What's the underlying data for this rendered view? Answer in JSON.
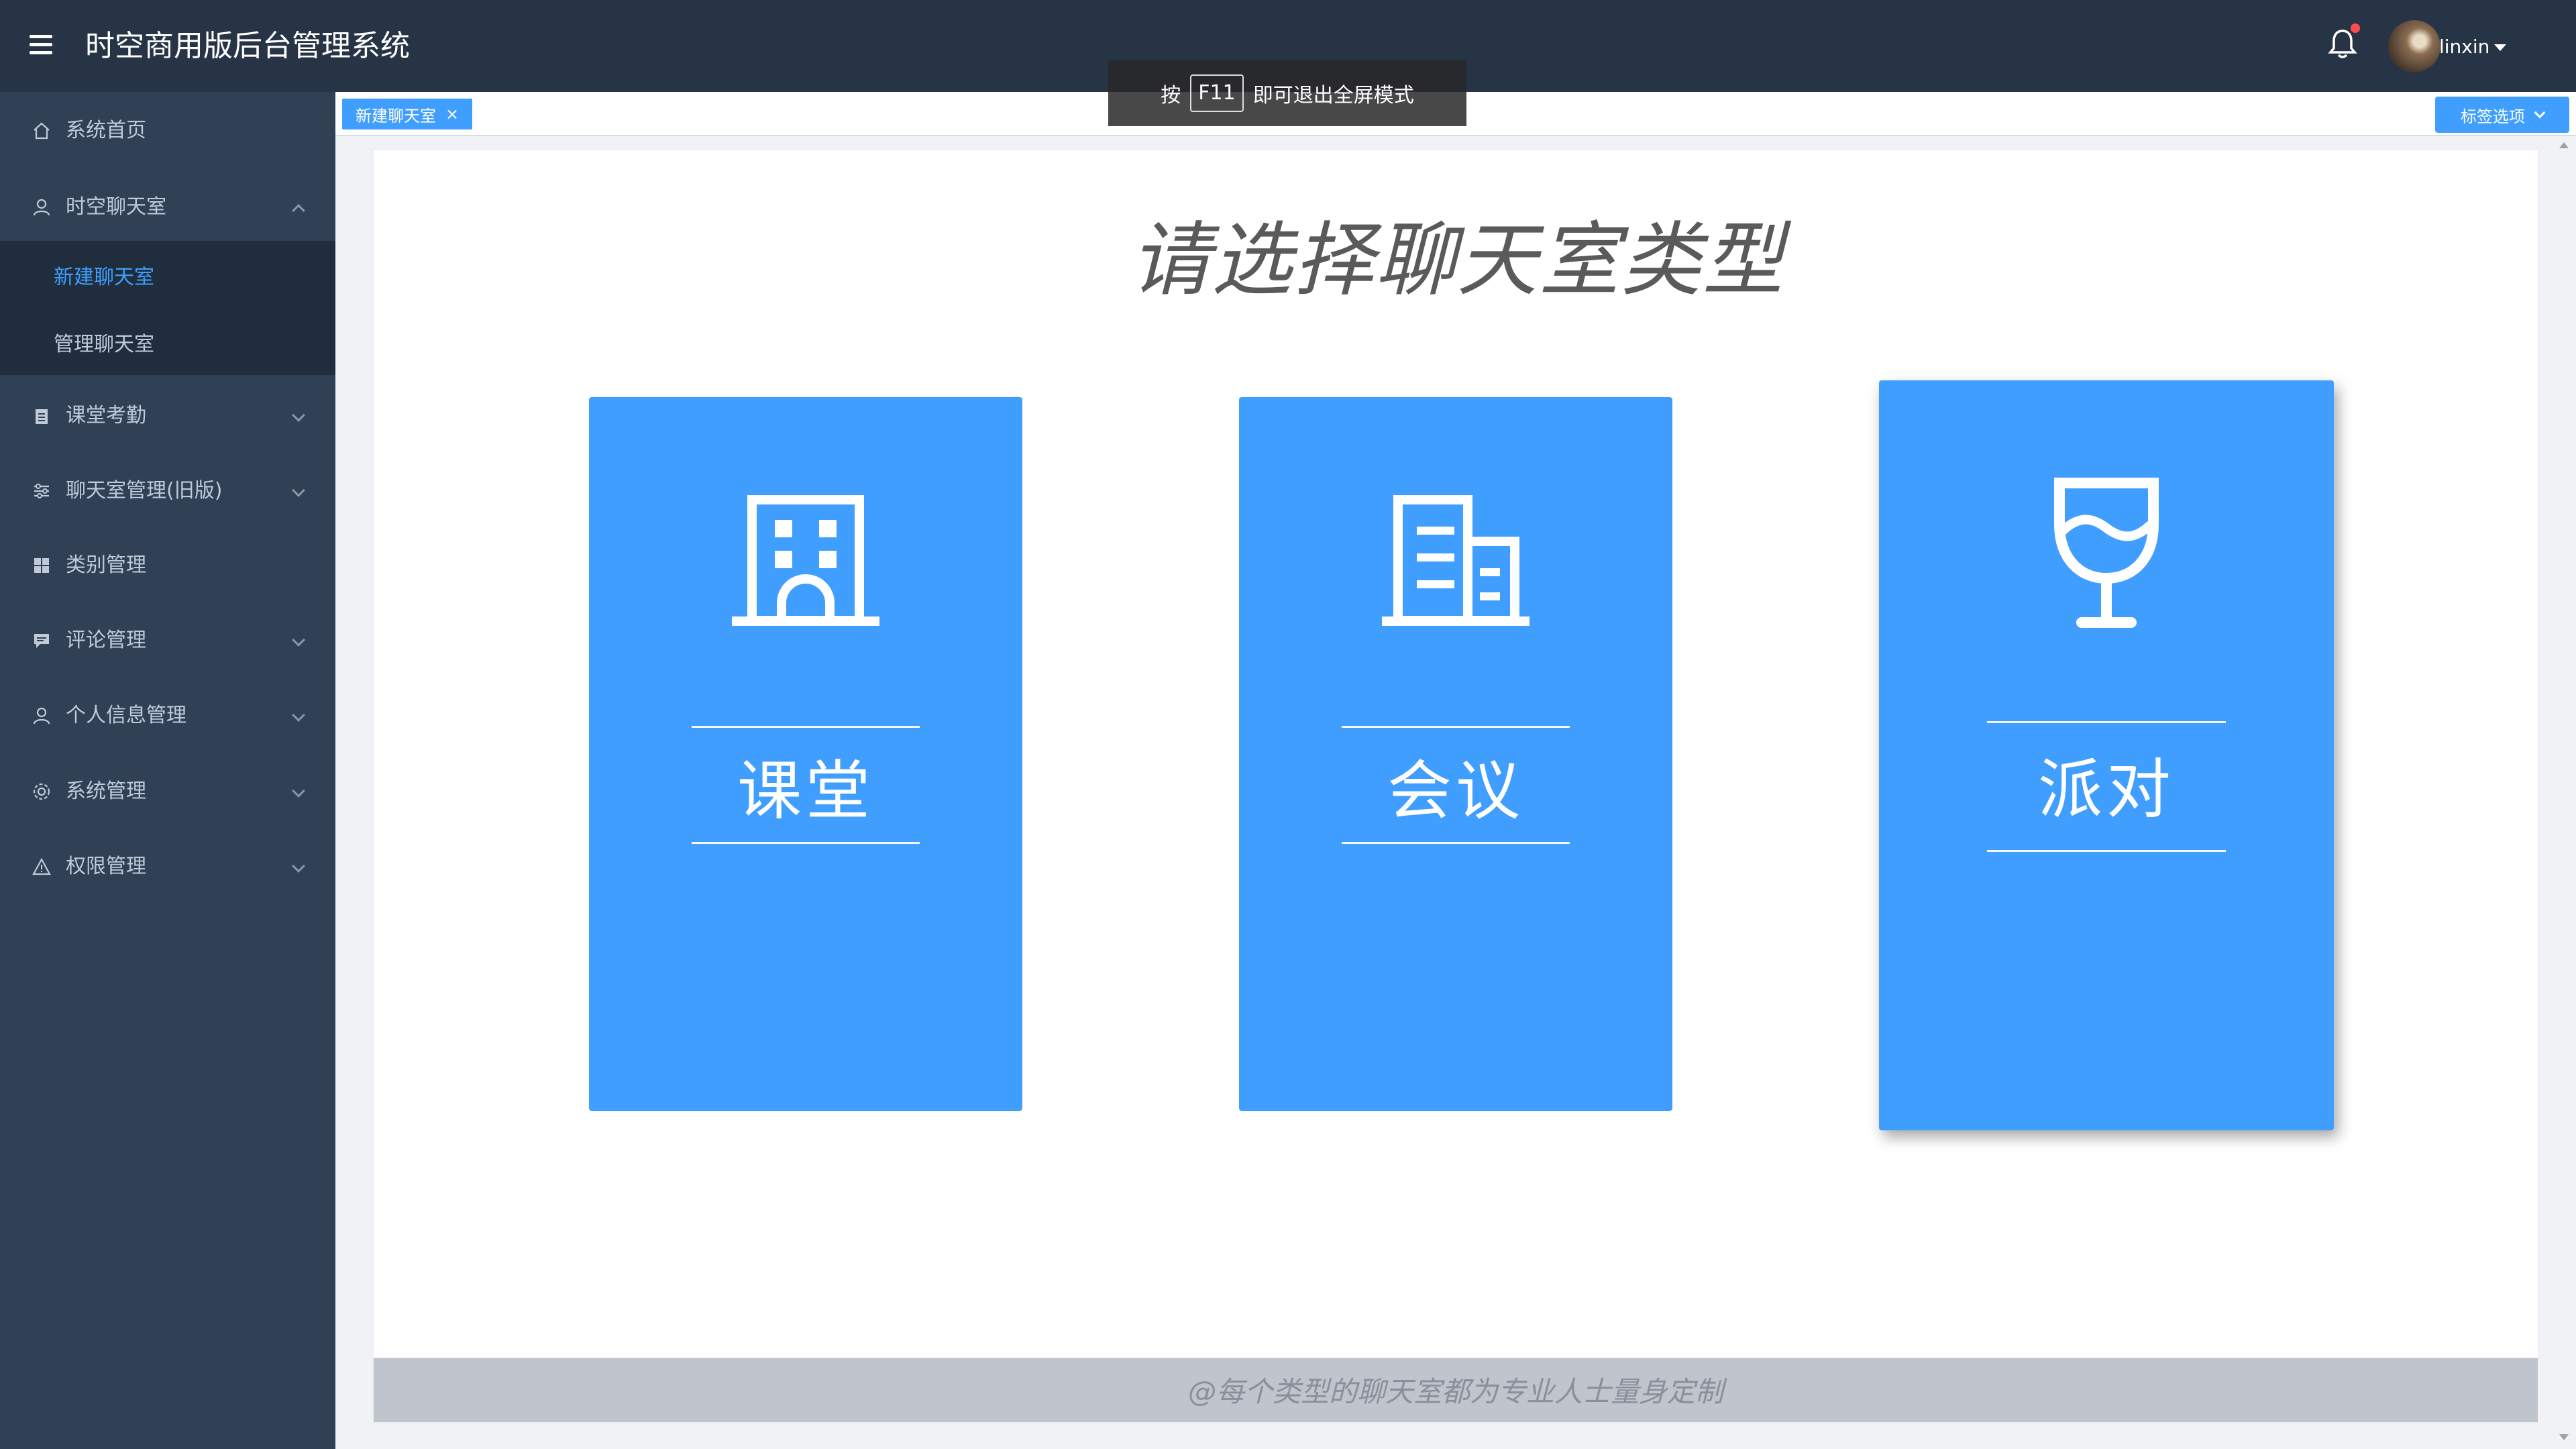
{
  "header": {
    "title": "时空商用版后台管理系统",
    "username": "linxin",
    "icons": {
      "menu": "hamburger-icon",
      "bell": "bell-icon",
      "avatar": "user-avatar"
    }
  },
  "fullscreen_hint": {
    "prefix": "按",
    "key": "F11",
    "suffix": "即可退出全屏模式"
  },
  "sidebar": {
    "items": [
      {
        "label": "系统首页",
        "icon": "home-icon",
        "expandable": false
      },
      {
        "label": "时空聊天室",
        "icon": "user-icon",
        "expandable": true,
        "expanded": true
      },
      {
        "label": "课堂考勤",
        "icon": "clipboard-icon",
        "expandable": true
      },
      {
        "label": "聊天室管理(旧版)",
        "icon": "sliders-icon",
        "expandable": true
      },
      {
        "label": "类别管理",
        "icon": "grid-icon",
        "expandable": false
      },
      {
        "label": "评论管理",
        "icon": "comment-icon",
        "expandable": true
      },
      {
        "label": "个人信息管理",
        "icon": "user-icon",
        "expandable": true
      },
      {
        "label": "系统管理",
        "icon": "gear-icon",
        "expandable": true
      },
      {
        "label": "权限管理",
        "icon": "warning-icon",
        "expandable": true
      }
    ],
    "subitems": [
      {
        "label": "新建聊天室",
        "active": true
      },
      {
        "label": "管理聊天室",
        "active": false
      }
    ]
  },
  "tags": {
    "active_tag": "新建聊天室",
    "close_symbol": "×",
    "options_label": "标签选项"
  },
  "main": {
    "title": "请选择聊天室类型",
    "cards": [
      {
        "label": "课堂",
        "icon": "building-icon"
      },
      {
        "label": "会议",
        "icon": "office-building-icon"
      },
      {
        "label": "派对",
        "icon": "wine-glass-icon"
      }
    ],
    "footer": "@每个类型的聊天室都为专业人士量身定制"
  },
  "colors": {
    "header_bg": "#263445",
    "sidebar_bg": "#304156",
    "accent": "#409eff",
    "footer_bar": "#c0c4cc"
  }
}
